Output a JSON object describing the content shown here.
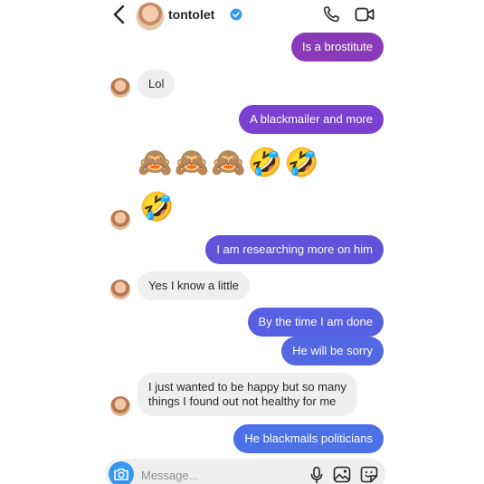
{
  "header": {
    "username": "tontolet",
    "verified": true
  },
  "messages": [
    {
      "from": "me",
      "text": "Is a brostitute"
    },
    {
      "from": "them",
      "text": "Lol"
    },
    {
      "from": "me",
      "text": "A blackmailer and more"
    },
    {
      "from": "me",
      "emoji": "🙈🙈🙈🤣🤣"
    },
    {
      "from": "them",
      "emoji": "🤣"
    },
    {
      "from": "me",
      "text": "I am researching more on him"
    },
    {
      "from": "them",
      "text": "Yes I know a little"
    },
    {
      "from": "me",
      "text": "By the time I am done"
    },
    {
      "from": "me",
      "text": "He will be  sorry"
    },
    {
      "from": "them",
      "text_lines": [
        "I just wanted to be happy but so many",
        "things I found out not healthy for me"
      ]
    },
    {
      "from": "me",
      "text": "He blackmails politicians"
    }
  ],
  "composer": {
    "placeholder": "Message..."
  },
  "colors": {
    "bubble_purple": "#8a3ab9",
    "bubble_violet": "#6a4fd8",
    "bubble_blue_violet": "#5b5be0",
    "bubble_blue": "#4a72e6",
    "bubble_incoming": "#efefef",
    "verified": "#3797f0",
    "camera": "#3797f0"
  },
  "icons": {
    "back": "chevron-left-icon",
    "verified": "verified-badge-icon",
    "call": "phone-icon",
    "video": "video-camera-icon",
    "camera": "camera-icon",
    "mic": "microphone-icon",
    "gallery": "gallery-icon",
    "sticker": "sticker-icon"
  }
}
